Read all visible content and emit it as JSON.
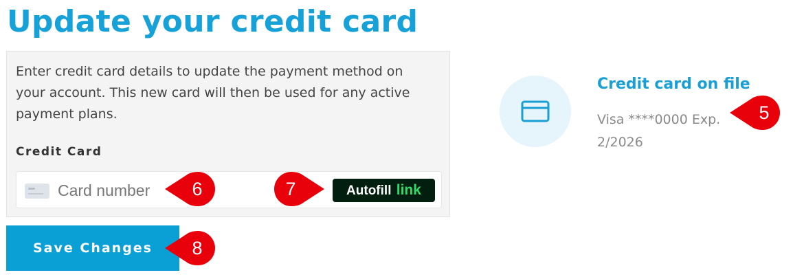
{
  "page": {
    "title": "Update your credit card"
  },
  "form": {
    "intro": "Enter credit card details to update the payment method on your account. This new card will then be used for any active payment plans.",
    "field_label": "Credit Card",
    "card_input": {
      "value": "",
      "placeholder": "Card number",
      "icon": "credit-card-icon"
    },
    "autofill_button": {
      "label": "Autofill",
      "brand": "link"
    },
    "save_label": "Save Changes"
  },
  "card_on_file": {
    "icon": "credit-card-icon",
    "title": "Credit card on file",
    "detail": "Visa ****0000 Exp. 2/2026"
  },
  "callouts": [
    {
      "number": "5"
    },
    {
      "number": "6"
    },
    {
      "number": "7"
    },
    {
      "number": "8"
    }
  ],
  "colors": {
    "accent": "#16a1d8",
    "button": "#0aa0d6",
    "callout": "#e8000b",
    "autofill_bg": "#011e0f",
    "autofill_brand": "#2fd86a"
  }
}
